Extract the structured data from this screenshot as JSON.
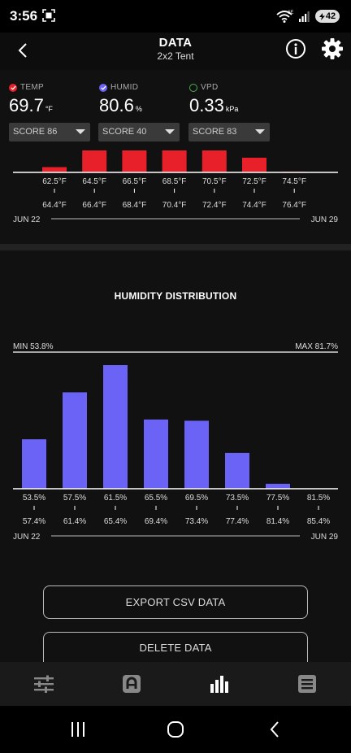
{
  "status_bar": {
    "time": "3:56",
    "network": "6E",
    "battery": "42"
  },
  "header": {
    "title": "DATA",
    "subtitle": "2x2 Tent"
  },
  "metrics": [
    {
      "label": "TEMP",
      "value": "69.7",
      "unit": "°F",
      "score": "SCORE 86",
      "color": "#e8202a"
    },
    {
      "label": "HUMID",
      "value": "80.6",
      "unit": "%",
      "score": "SCORE 40",
      "color": "#6a63f6"
    },
    {
      "label": "VPD",
      "value": "0.33",
      "unit": "kPa",
      "score": "SCORE 83",
      "color": "#4caf50"
    }
  ],
  "temp_chart": {
    "type": "bar",
    "color": "#e8202a",
    "bins_low": [
      "62.5°F",
      "64.5°F",
      "66.5°F",
      "68.5°F",
      "70.5°F",
      "72.5°F",
      "74.5°F"
    ],
    "bins_high": [
      "64.4°F",
      "66.4°F",
      "68.4°F",
      "70.4°F",
      "72.4°F",
      "74.4°F",
      "76.4°F"
    ],
    "values": [
      0.24,
      1.0,
      1.0,
      1.0,
      1.0,
      0.67,
      0.03
    ],
    "date_start": "JUN 22",
    "date_end": "JUN 29"
  },
  "chart_data": {
    "type": "bar",
    "title": "HUMIDITY DISTRIBUTION",
    "color": "#6a63f6",
    "min_label": "MIN 53.8%",
    "max_label": "MAX 81.7%",
    "bins_low": [
      "53.5%",
      "57.5%",
      "61.5%",
      "65.5%",
      "69.5%",
      "73.5%",
      "77.5%",
      "81.5%"
    ],
    "bins_high": [
      "57.4%",
      "61.4%",
      "65.4%",
      "69.4%",
      "73.4%",
      "77.4%",
      "81.4%",
      "85.4%"
    ],
    "values": [
      0.4,
      0.78,
      1.0,
      0.56,
      0.55,
      0.29,
      0.04,
      0
    ],
    "date_start": "JUN 22",
    "date_end": "JUN 29"
  },
  "actions": {
    "export": "EXPORT CSV DATA",
    "delete": "DELETE DATA"
  },
  "nav": [
    "sliders",
    "app",
    "chart",
    "list"
  ]
}
